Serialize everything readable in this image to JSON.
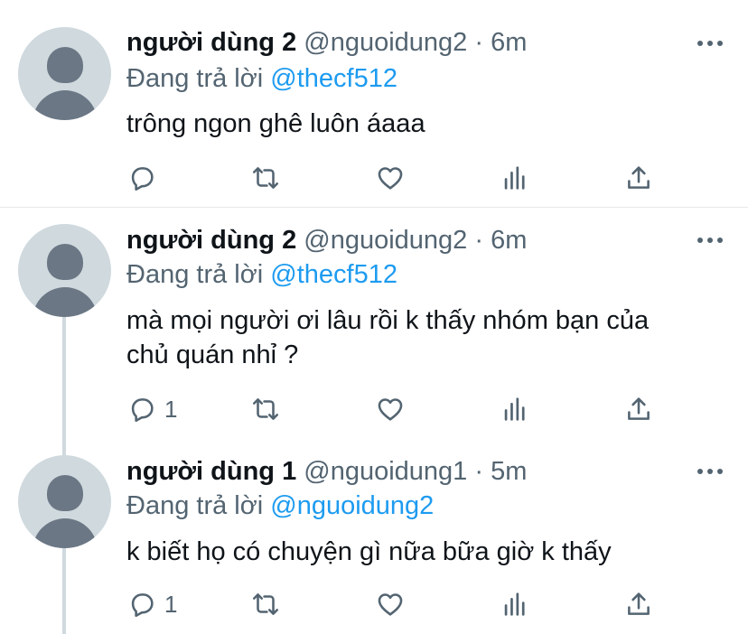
{
  "tweets": [
    {
      "name": "người dùng 2",
      "handle": "@nguoidung2",
      "dot": "·",
      "time": "6m",
      "reply_prefix": "Đang trả lời",
      "reply_to": "@thecf512",
      "text": "trông ngon ghê luôn áaaa",
      "reply_count": ""
    },
    {
      "name": "người dùng 2",
      "handle": "@nguoidung2",
      "dot": "·",
      "time": "6m",
      "reply_prefix": "Đang trả lời",
      "reply_to": "@thecf512",
      "text_line1": "mà mọi người ơi lâu rồi k thấy nhóm bạn của",
      "text_line2": "chủ quán nhỉ ?",
      "reply_count": "1"
    },
    {
      "name": "người dùng 1",
      "handle": "@nguoidung1",
      "dot": "·",
      "time": "5m",
      "reply_prefix": "Đang trả lời",
      "reply_to": "@nguoidung2",
      "text": "k biết họ có chuyện gì nữa bữa giờ k thấy",
      "reply_count": "1"
    }
  ],
  "icons": {
    "reply": "reply-icon",
    "retweet": "retweet-icon",
    "like": "heart-icon",
    "views": "analytics-icon",
    "share": "share-icon",
    "more": "more-icon"
  },
  "colors": {
    "mention": "#1d9bf0",
    "secondary_text": "#536471",
    "avatar_bg": "#cfd9de",
    "avatar_fg": "#6b7785"
  }
}
